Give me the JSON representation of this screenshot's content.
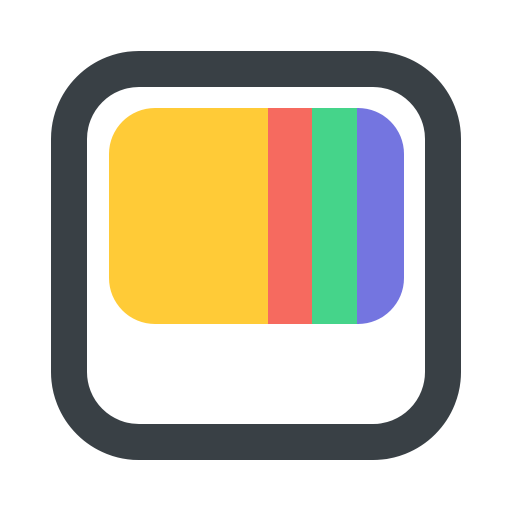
{
  "icon": {
    "name": "color-swatch-card-icon",
    "frame_color": "#394045",
    "frame_fill": "#ffffff",
    "stripes": [
      {
        "name": "yellow-stripe",
        "color": "#ffcb37"
      },
      {
        "name": "red-stripe",
        "color": "#f66a5f"
      },
      {
        "name": "green-stripe",
        "color": "#45d48a"
      },
      {
        "name": "purple-stripe",
        "color": "#7475e0"
      }
    ]
  }
}
